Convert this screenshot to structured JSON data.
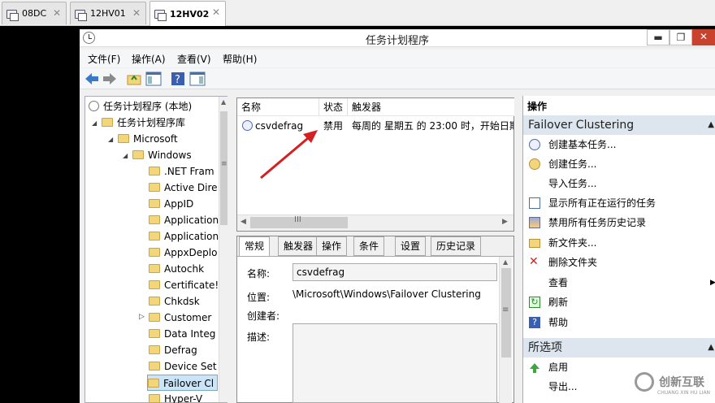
{
  "remote_tabs": [
    {
      "label": "08DC"
    },
    {
      "label": "12HV01"
    },
    {
      "label": "12HV02"
    }
  ],
  "window": {
    "title": "任务计划程序",
    "min": "▬",
    "max": "❐",
    "close": "✕"
  },
  "menu": [
    "文件(F)",
    "操作(A)",
    "查看(V)",
    "帮助(H)"
  ],
  "tree": {
    "items": [
      {
        "label": "任务计划程序 (本地)"
      },
      {
        "label": "任务计划程序库"
      },
      {
        "label": "Microsoft"
      },
      {
        "label": "Windows"
      },
      {
        "label": ".NET Fram"
      },
      {
        "label": "Active Dire"
      },
      {
        "label": "AppID"
      },
      {
        "label": "Application"
      },
      {
        "label": "Application"
      },
      {
        "label": "AppxDeplo"
      },
      {
        "label": "Autochk"
      },
      {
        "label": "Certificate!"
      },
      {
        "label": "Chkdsk"
      },
      {
        "label": "Customer"
      },
      {
        "label": "Data Integ"
      },
      {
        "label": "Defrag"
      },
      {
        "label": "Device Set"
      },
      {
        "label": "Failover Cl"
      },
      {
        "label": "Hyper-V"
      }
    ]
  },
  "task_list": {
    "headers": [
      "名称",
      "状态",
      "触发器"
    ],
    "rows": [
      {
        "name": "csvdefrag",
        "status": "禁用",
        "trigger": "每周的 星期五 的 23:00 时，开始日期"
      }
    ]
  },
  "detail": {
    "tabs": [
      "常规",
      "触发器",
      "操作",
      "条件",
      "设置",
      "历史记录"
    ],
    "name_label": "名称:",
    "name_value": "csvdefrag",
    "location_label": "位置:",
    "location_value": "\\Microsoft\\Windows\\Failover Clustering",
    "author_label": "创建者:",
    "desc_label": "描述:"
  },
  "actions": {
    "header": "操作",
    "section1": "Failover Clustering",
    "items1": [
      "创建基本任务...",
      "创建任务...",
      "导入任务...",
      "显示所有正在运行的任务",
      "禁用所有任务历史记录",
      "新文件夹...",
      "删除文件夹",
      "查看",
      "刷新",
      "帮助"
    ],
    "section2": "所选项",
    "items2": [
      "启用",
      "导出..."
    ]
  },
  "watermark": {
    "text": "创新互联",
    "sub": "CHUANG XIN HU LIAN"
  },
  "colors": {
    "accent": "#3a78c8",
    "close": "#c8422e",
    "section": "#dde5ef",
    "arrow": "#d42020"
  }
}
